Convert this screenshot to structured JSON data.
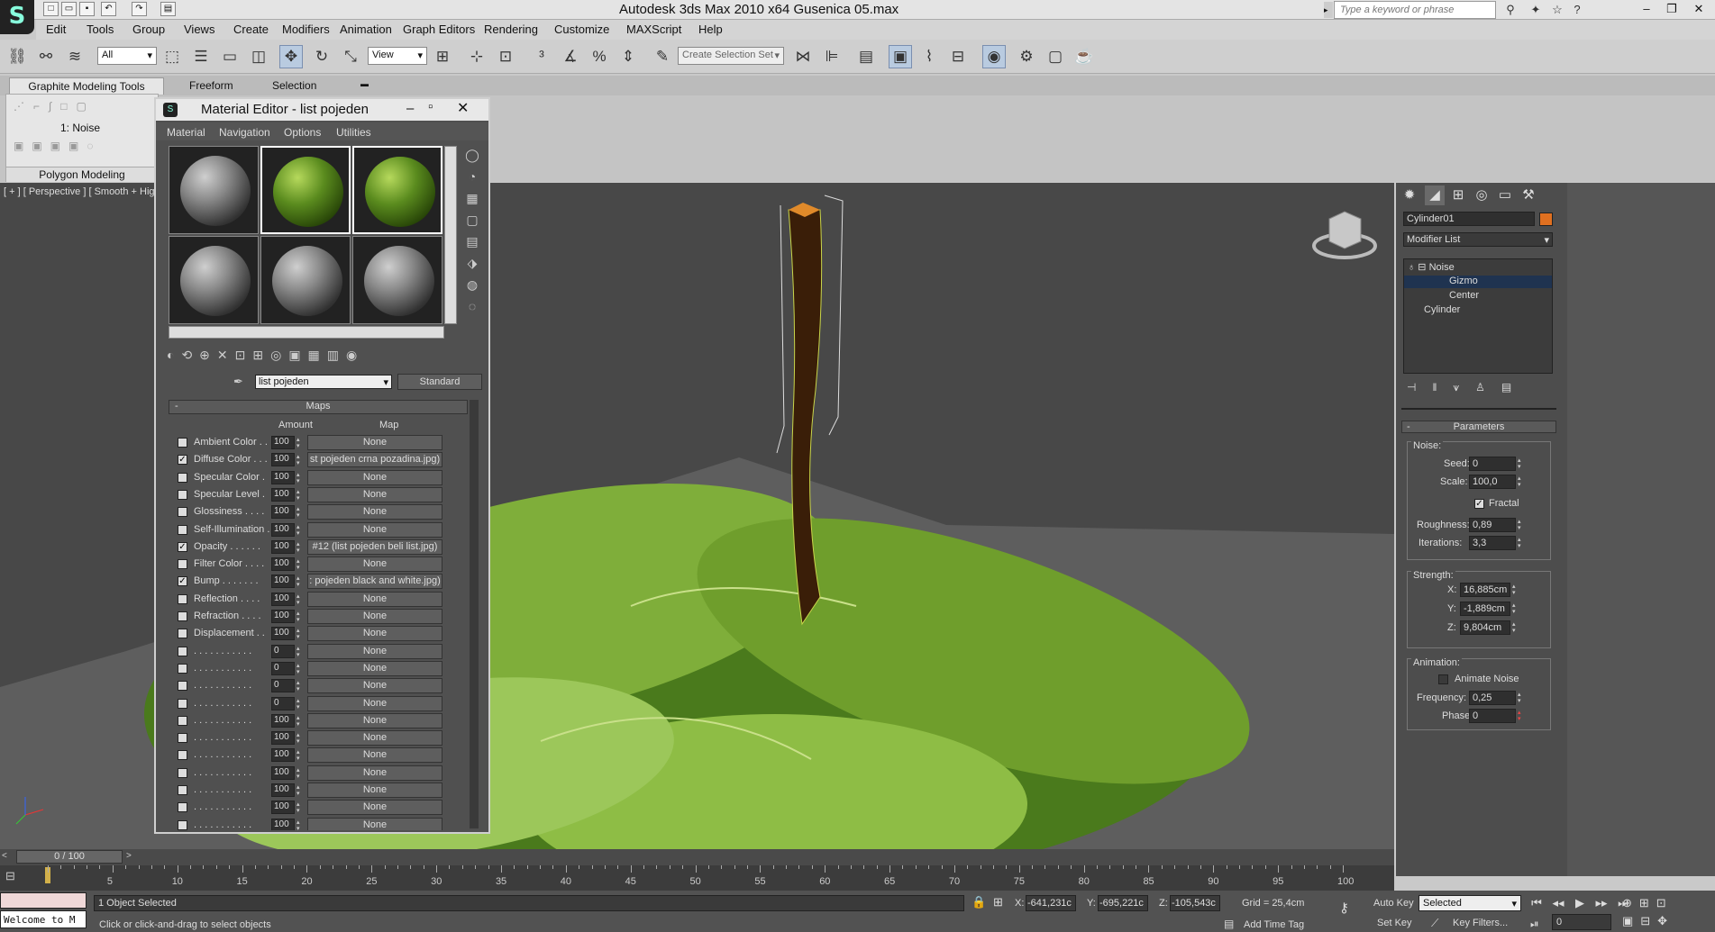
{
  "window": {
    "title": "Autodesk 3ds Max  2010 x64      Gusenica 05.max",
    "search_placeholder": "Type a keyword or phrase"
  },
  "menu": [
    "Edit",
    "Tools",
    "Group",
    "Views",
    "Create",
    "Modifiers",
    "Animation",
    "Graph Editors",
    "Rendering",
    "Customize",
    "MAXScript",
    "Help"
  ],
  "toolbar": {
    "selection_filter": "All",
    "ref_coord": "View",
    "named_selection": "Create Selection Set"
  },
  "ribbon": {
    "tabs": [
      "Graphite Modeling Tools",
      "Freeform",
      "Selection"
    ],
    "stack_label": "1: Noise",
    "panel_label": "Polygon Modeling"
  },
  "viewport": {
    "label": "[ + ] [ Perspective ] [ Smooth + High"
  },
  "material_editor": {
    "title": "Material Editor - list pojeden",
    "menu": [
      "Material",
      "Navigation",
      "Options",
      "Utilities"
    ],
    "material_name": "list pojeden",
    "material_type": "Standard",
    "rollout": "Maps",
    "col_amount": "Amount",
    "col_map": "Map",
    "maps": [
      {
        "label": "Ambient Color . .",
        "checked": false,
        "amount": "100",
        "map": "None"
      },
      {
        "label": "Diffuse Color . . .",
        "checked": true,
        "amount": "100",
        "map": "st pojeden crna pozadina.jpg)"
      },
      {
        "label": "Specular Color .",
        "checked": false,
        "amount": "100",
        "map": "None"
      },
      {
        "label": "Specular Level .",
        "checked": false,
        "amount": "100",
        "map": "None"
      },
      {
        "label": "Glossiness . . . .",
        "checked": false,
        "amount": "100",
        "map": "None"
      },
      {
        "label": "Self-Illumination .",
        "checked": false,
        "amount": "100",
        "map": "None"
      },
      {
        "label": "Opacity . . . . . .",
        "checked": true,
        "amount": "100",
        "map": "#12 (list pojeden beli list.jpg)"
      },
      {
        "label": "Filter Color . . . .",
        "checked": false,
        "amount": "100",
        "map": "None"
      },
      {
        "label": "Bump . . . . . . .",
        "checked": true,
        "amount": "100",
        "map": ": pojeden black and white.jpg)"
      },
      {
        "label": "Reflection . . . .",
        "checked": false,
        "amount": "100",
        "map": "None"
      },
      {
        "label": "Refraction . . . .",
        "checked": false,
        "amount": "100",
        "map": "None"
      },
      {
        "label": "Displacement . .",
        "checked": false,
        "amount": "100",
        "map": "None"
      },
      {
        "label": ". . . . . . . . . . .",
        "checked": false,
        "amount": "0",
        "map": "None"
      },
      {
        "label": ". . . . . . . . . . .",
        "checked": false,
        "amount": "0",
        "map": "None"
      },
      {
        "label": ". . . . . . . . . . .",
        "checked": false,
        "amount": "0",
        "map": "None"
      },
      {
        "label": ". . . . . . . . . . .",
        "checked": false,
        "amount": "0",
        "map": "None"
      },
      {
        "label": ". . . . . . . . . . .",
        "checked": false,
        "amount": "100",
        "map": "None"
      },
      {
        "label": ". . . . . . . . . . .",
        "checked": false,
        "amount": "100",
        "map": "None"
      },
      {
        "label": ". . . . . . . . . . .",
        "checked": false,
        "amount": "100",
        "map": "None"
      },
      {
        "label": ". . . . . . . . . . .",
        "checked": false,
        "amount": "100",
        "map": "None"
      },
      {
        "label": ". . . . . . . . . . .",
        "checked": false,
        "amount": "100",
        "map": "None"
      },
      {
        "label": ". . . . . . . . . . .",
        "checked": false,
        "amount": "100",
        "map": "None"
      },
      {
        "label": ". . . . . . . . . . .",
        "checked": false,
        "amount": "100",
        "map": "None"
      }
    ]
  },
  "command_panel": {
    "object_name": "Cylinder01",
    "modifier_list": "Modifier List",
    "stack": [
      "Noise",
      "Gizmo",
      "Center",
      "Cylinder"
    ],
    "params_title": "Parameters",
    "noise_group": "Noise:",
    "seed_label": "Seed:",
    "seed": "0",
    "scale_label": "Scale:",
    "scale": "100,0",
    "fractal_label": "Fractal",
    "roughness_label": "Roughness:",
    "roughness": "0,89",
    "iterations_label": "Iterations:",
    "iterations": "3,3",
    "strength_group": "Strength:",
    "x_label": "X:",
    "x": "16,885cm",
    "y_label": "Y:",
    "y": "-1,889cm",
    "z_label": "Z:",
    "z": "9,804cm",
    "anim_group": "Animation:",
    "animate_label": "Animate Noise",
    "frequency_label": "Frequency:",
    "frequency": "0,25",
    "phase_label": "Phase:",
    "phase": "0"
  },
  "timeline": {
    "frame": "0 / 100",
    "ticks": [
      "5",
      "10",
      "15",
      "20",
      "25",
      "30",
      "35",
      "40",
      "45",
      "50",
      "55",
      "60",
      "65",
      "70",
      "75",
      "80",
      "85",
      "90",
      "95",
      "100"
    ]
  },
  "status": {
    "listener": "Welcome to M",
    "selected": "1 Object Selected",
    "prompt": "Click or click-and-drag to select objects",
    "x_label": "X:",
    "x": "-641,231c",
    "y_label": "Y:",
    "y": "-695,221c",
    "z_label": "Z:",
    "z": "-105,543c",
    "grid": "Grid = 25,4cm",
    "add_time_tag": "Add Time Tag",
    "auto_key": "Auto Key",
    "set_key": "Set Key",
    "key_mode": "Selected",
    "key_filters": "Key Filters...",
    "frame_field": "0"
  }
}
